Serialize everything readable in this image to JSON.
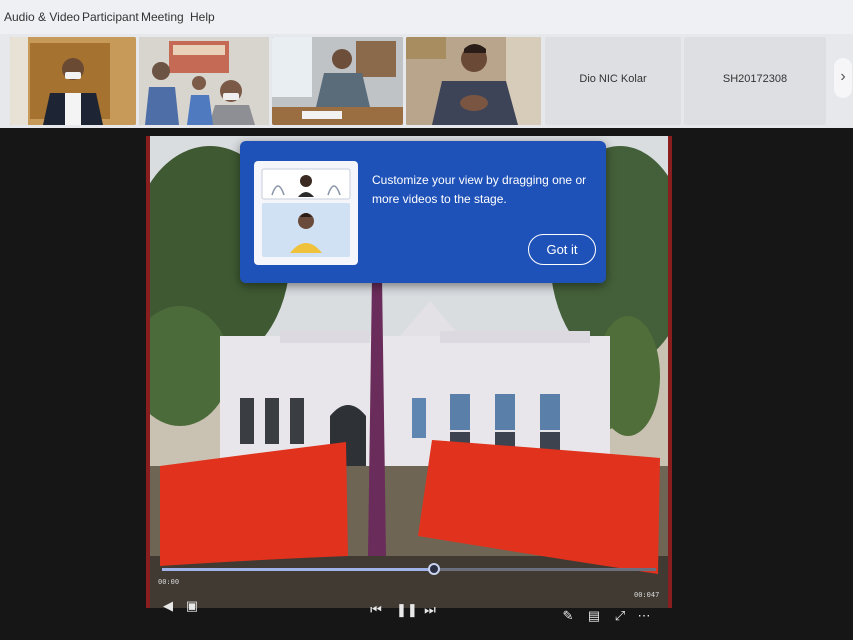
{
  "menu": {
    "items": [
      "Audio & Video",
      "Participant",
      "Meeting",
      "Help"
    ]
  },
  "participants": {
    "video_tiles": 4,
    "named_tiles": [
      {
        "name": "Dio NIC Kolar"
      },
      {
        "name": "SH20172308"
      }
    ]
  },
  "callout": {
    "message": "Customize your view by dragging one or more videos to the stage.",
    "button_label": "Got it"
  },
  "player": {
    "elapsed": "00:00",
    "remaining": "00:047",
    "progress": 0.55
  },
  "icons": {
    "strip_next": "chevron-right-icon",
    "audio": "speaker-icon",
    "screen": "screen-icon",
    "prev": "previous-icon",
    "pause": "pause-icon",
    "next": "next-icon",
    "pen": "pen-icon",
    "caption": "caption-icon",
    "fullscreen": "fullscreen-icon",
    "more": "more-icon"
  },
  "colors": {
    "callout_bg": "#1f52b8",
    "stage_bg": "#161616",
    "video_border": "#8a1e1e"
  }
}
